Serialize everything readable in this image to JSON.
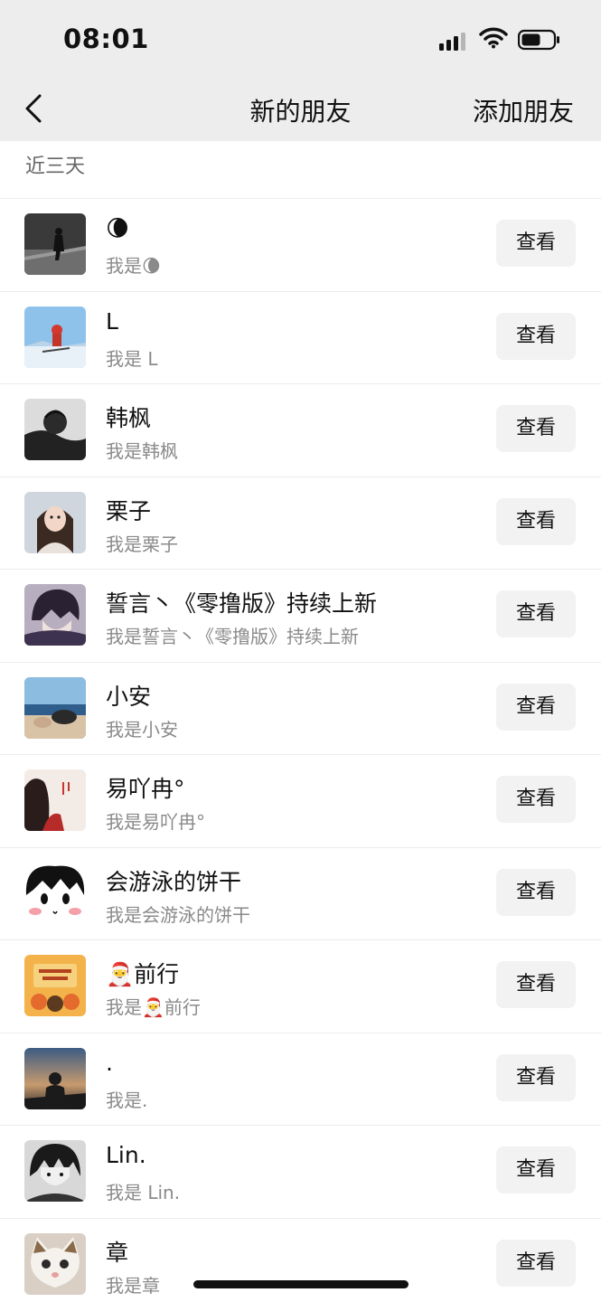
{
  "status_bar": {
    "time": "08:01"
  },
  "nav": {
    "title": "新的朋友",
    "add_friend": "添加朋友"
  },
  "section": {
    "label": "近三天"
  },
  "contacts": [
    {
      "name": "🌘",
      "message": "我是🌘",
      "button": "查看"
    },
    {
      "name": "L",
      "message": "我是 L",
      "button": "查看"
    },
    {
      "name": "韩枫",
      "message": "我是韩枫",
      "button": "查看"
    },
    {
      "name": "栗子",
      "message": "我是栗子",
      "button": "查看"
    },
    {
      "name": "誓言丶《零撸版》持续上新",
      "message": "我是誓言丶《零撸版》持续上新",
      "button": "查看"
    },
    {
      "name": "小安",
      "message": "我是小安",
      "button": "查看"
    },
    {
      "name": "易吖冉°",
      "message": "我是易吖冉°",
      "button": "查看"
    },
    {
      "name": "会游泳的饼干",
      "message": "我是会游泳的饼干",
      "button": "查看"
    },
    {
      "name": "🎅前行",
      "message": "我是🎅前行",
      "button": "查看"
    },
    {
      "name": ".",
      "message": "我是.",
      "button": "查看"
    },
    {
      "name": "Lin.",
      "message": "我是 Lin.",
      "button": "查看"
    },
    {
      "name": "章",
      "message": "我是章",
      "button": "查看"
    }
  ]
}
